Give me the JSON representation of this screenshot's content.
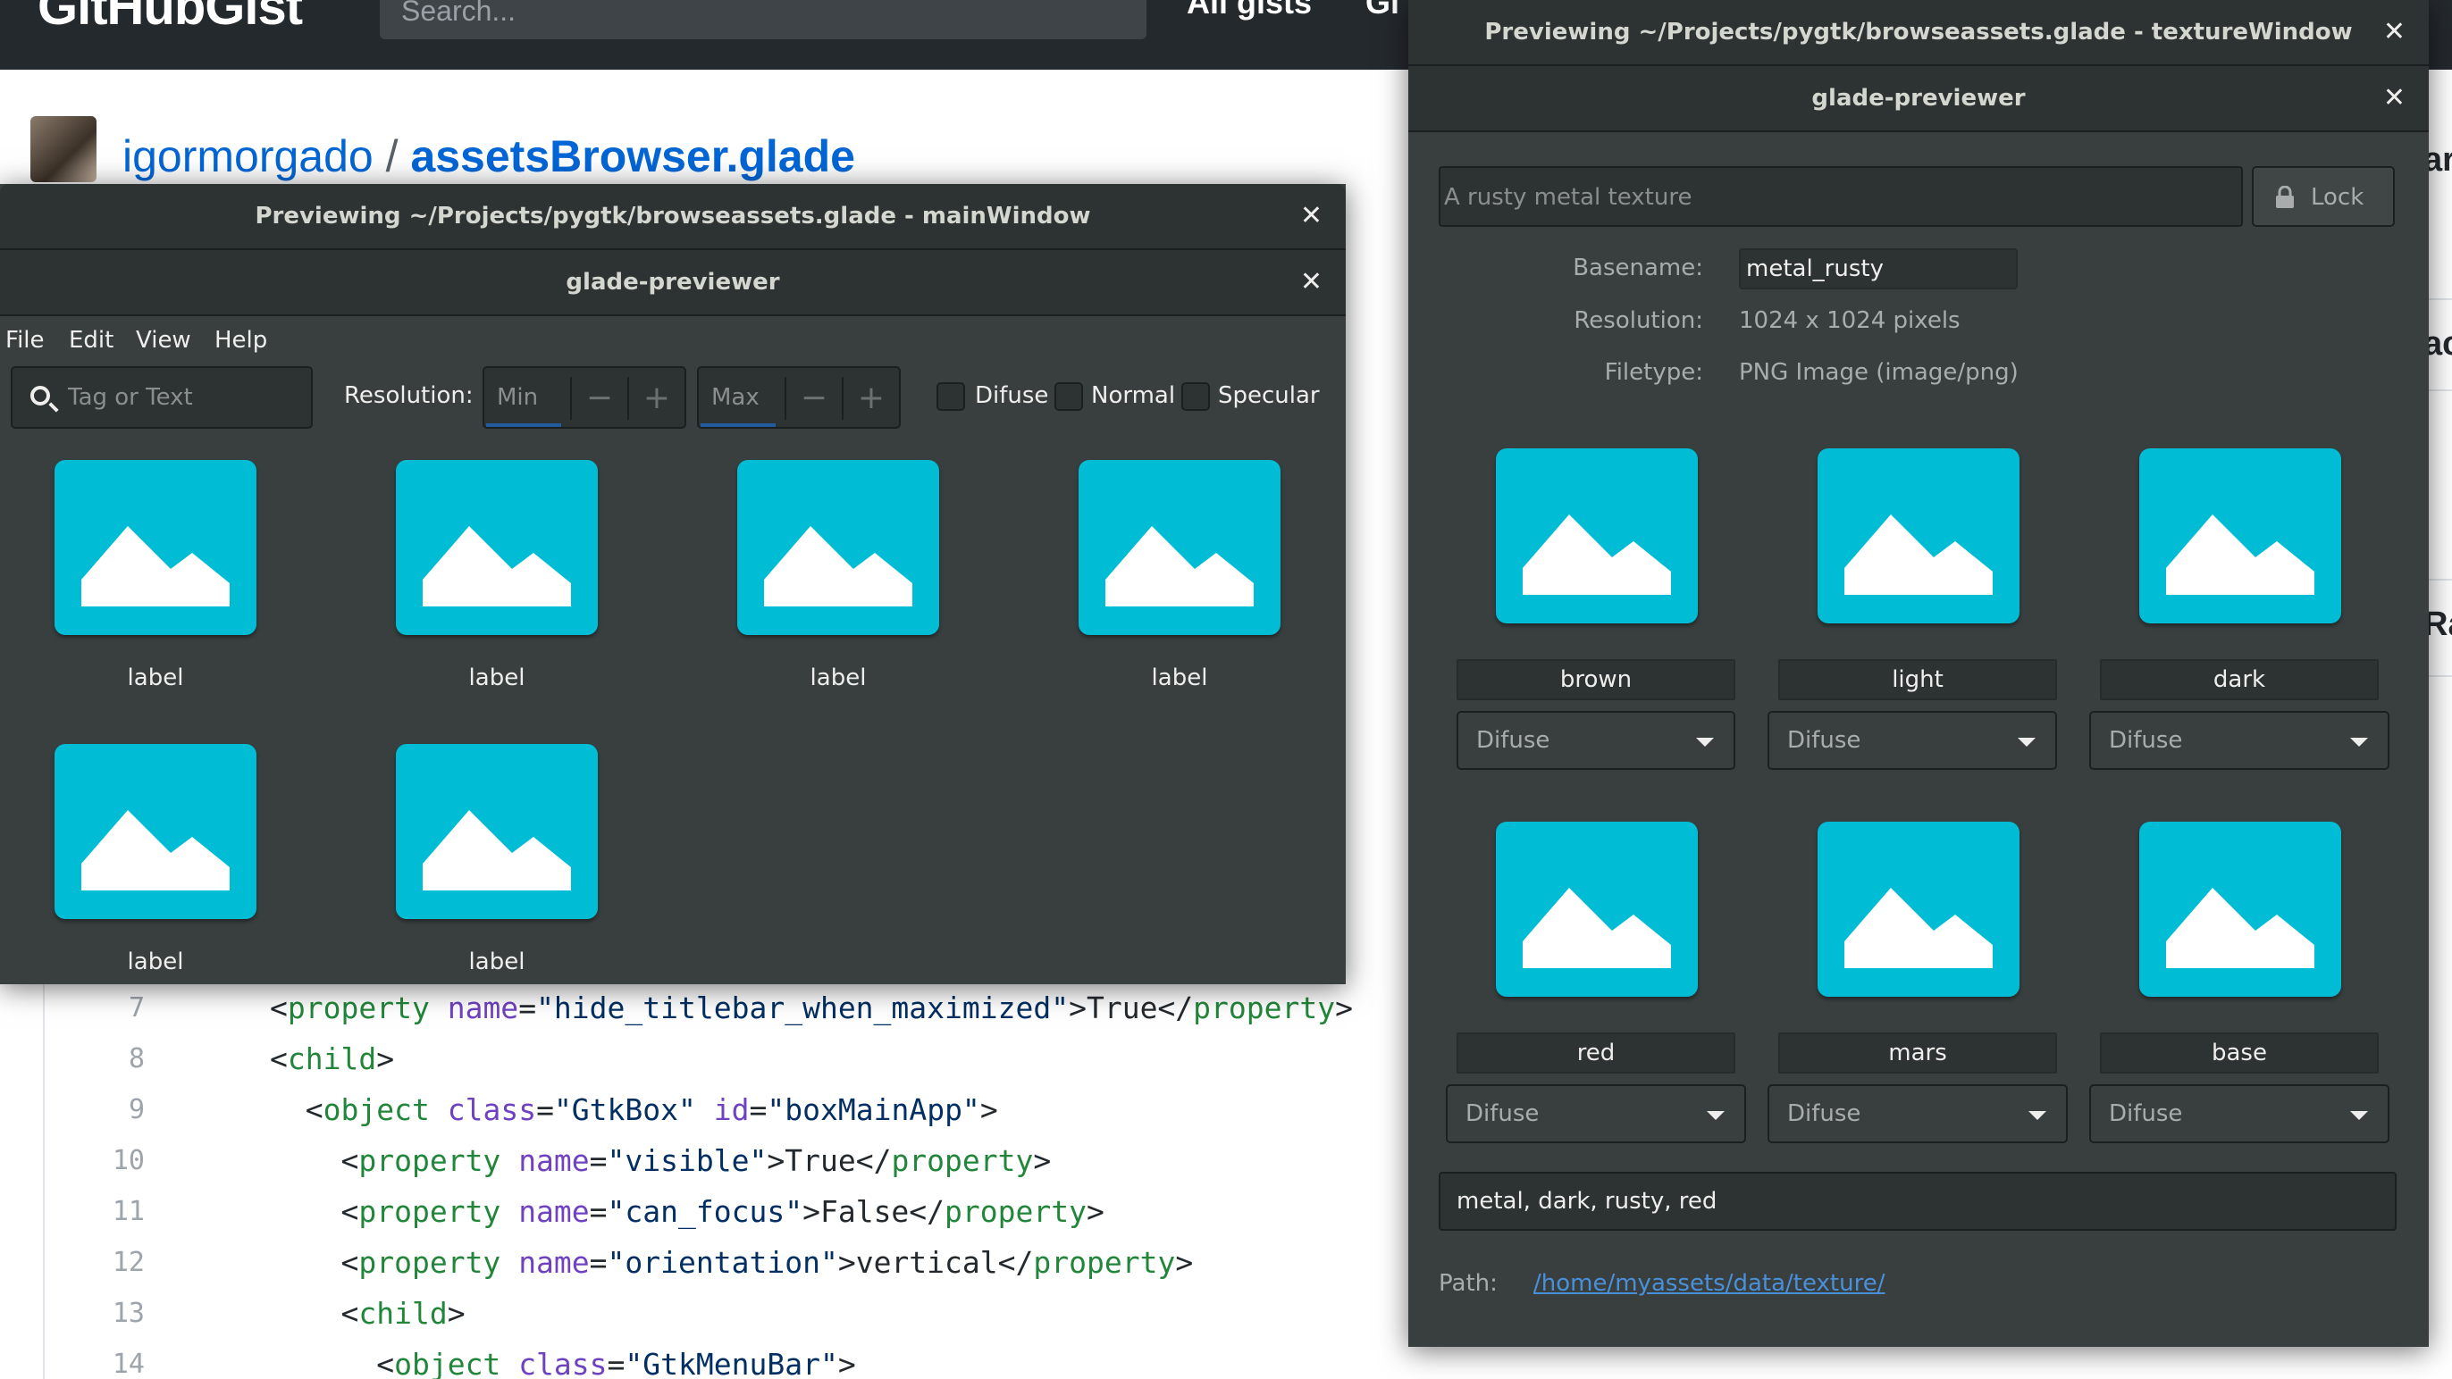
{
  "github": {
    "logo": "GitHubGist",
    "search_placeholder": "Search...",
    "nav": [
      "All gists",
      "Gi"
    ],
    "user": "igormorgado",
    "separator": "/",
    "gist_name": "assetsBrowser.glade",
    "right_cut": [
      "ar",
      "ac",
      "Ra"
    ],
    "code_lines": [
      {
        "n": "7",
        "indent": "",
        "parts": [
          [
            "t",
            "<"
          ],
          [
            "tag",
            "property"
          ],
          [
            "t",
            " "
          ],
          [
            "attr",
            "name"
          ],
          [
            "t",
            "="
          ],
          [
            "str",
            "\"hide_titlebar_when_maximized\""
          ],
          [
            "t",
            ">True</"
          ],
          [
            "tag",
            "property"
          ],
          [
            "t",
            ">"
          ]
        ]
      },
      {
        "n": "8",
        "indent": "",
        "parts": [
          [
            "t",
            "<"
          ],
          [
            "tag",
            "child"
          ],
          [
            "t",
            ">"
          ]
        ]
      },
      {
        "n": "9",
        "indent": "  ",
        "parts": [
          [
            "t",
            "<"
          ],
          [
            "tag",
            "object"
          ],
          [
            "t",
            " "
          ],
          [
            "attr",
            "class"
          ],
          [
            "t",
            "="
          ],
          [
            "str",
            "\"GtkBox\""
          ],
          [
            "t",
            " "
          ],
          [
            "attr",
            "id"
          ],
          [
            "t",
            "="
          ],
          [
            "str",
            "\"boxMainApp\""
          ],
          [
            "t",
            ">"
          ]
        ]
      },
      {
        "n": "10",
        "indent": "    ",
        "parts": [
          [
            "t",
            "<"
          ],
          [
            "tag",
            "property"
          ],
          [
            "t",
            " "
          ],
          [
            "attr",
            "name"
          ],
          [
            "t",
            "="
          ],
          [
            "str",
            "\"visible\""
          ],
          [
            "t",
            ">True</"
          ],
          [
            "tag",
            "property"
          ],
          [
            "t",
            ">"
          ]
        ]
      },
      {
        "n": "11",
        "indent": "    ",
        "parts": [
          [
            "t",
            "<"
          ],
          [
            "tag",
            "property"
          ],
          [
            "t",
            " "
          ],
          [
            "attr",
            "name"
          ],
          [
            "t",
            "="
          ],
          [
            "str",
            "\"can_focus\""
          ],
          [
            "t",
            ">False</"
          ],
          [
            "tag",
            "property"
          ],
          [
            "t",
            ">"
          ]
        ]
      },
      {
        "n": "12",
        "indent": "    ",
        "parts": [
          [
            "t",
            "<"
          ],
          [
            "tag",
            "property"
          ],
          [
            "t",
            " "
          ],
          [
            "attr",
            "name"
          ],
          [
            "t",
            "="
          ],
          [
            "str",
            "\"orientation\""
          ],
          [
            "t",
            ">vertical</"
          ],
          [
            "tag",
            "property"
          ],
          [
            "t",
            ">"
          ]
        ]
      },
      {
        "n": "13",
        "indent": "    ",
        "parts": [
          [
            "t",
            "<"
          ],
          [
            "tag",
            "child"
          ],
          [
            "t",
            ">"
          ]
        ]
      },
      {
        "n": "14",
        "indent": "      ",
        "parts": [
          [
            "t",
            "<"
          ],
          [
            "tag",
            "object"
          ],
          [
            "t",
            " "
          ],
          [
            "attr",
            "class"
          ],
          [
            "t",
            "="
          ],
          [
            "str",
            "\"GtkMenuBar\""
          ],
          [
            "t",
            ">"
          ]
        ]
      }
    ]
  },
  "main_window": {
    "title": "Previewing ~/Projects/pygtk/browseassets.glade - mainWindow",
    "subtitle": "glade-previewer",
    "menu": [
      "File",
      "Edit",
      "View",
      "Help"
    ],
    "search_placeholder": "Tag or Text",
    "resolution_label": "Resolution:",
    "min_placeholder": "Min",
    "max_placeholder": "Max",
    "minus": "−",
    "plus": "+",
    "checks": [
      "Difuse",
      "Normal",
      "Specular"
    ],
    "tiles": [
      "label",
      "label",
      "label",
      "label",
      "label",
      "label"
    ]
  },
  "texture_window": {
    "title": "Previewing ~/Projects/pygtk/browseassets.glade - textureWindow",
    "subtitle": "glade-previewer",
    "description_placeholder": "A rusty metal texture",
    "lock_label": "Lock",
    "basename_label": "Basename:",
    "basename_value": "metal_rusty",
    "resolution_label": "Resolution:",
    "resolution_value": "1024 x 1024 pixels",
    "filetype_label": "Filetype:",
    "filetype_value": "PNG Image (image/png)",
    "variants": [
      {
        "name": "brown",
        "map": "Difuse"
      },
      {
        "name": "light",
        "map": "Difuse"
      },
      {
        "name": "dark",
        "map": "Difuse"
      },
      {
        "name": "red",
        "map": "Difuse"
      },
      {
        "name": "mars",
        "map": "Difuse"
      },
      {
        "name": "base",
        "map": "Difuse"
      }
    ],
    "tags": "metal, dark, rusty, red",
    "path_label": "Path:",
    "path_value": "/home/myassets/data/texture/"
  },
  "colors": {
    "tile": "#00bcd4",
    "window_bg": "#393f3f",
    "titlebar_bg": "#2d3232",
    "link": "#0366d6"
  },
  "icons": {
    "tile_icon": "image-placeholder-icon",
    "search_icon": "magnifier-icon",
    "lock_icon": "padlock-icon",
    "close_icon": "close-icon",
    "dropdown_icon": "triangle-down-icon"
  }
}
